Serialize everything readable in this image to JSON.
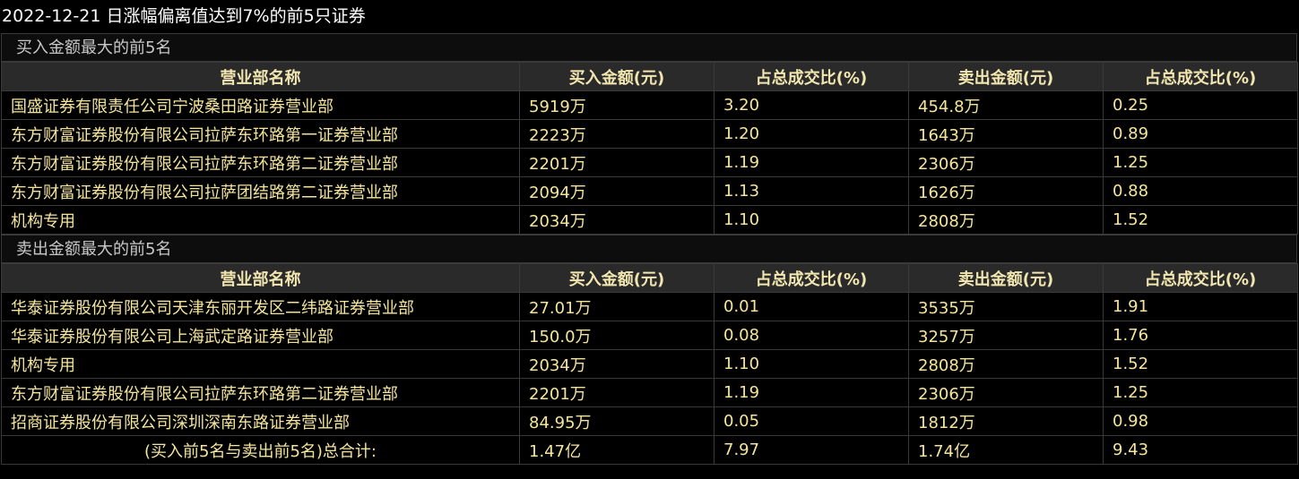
{
  "title": "2022-12-21 日涨幅偏离值达到7%的前5只证券",
  "headers": [
    "营业部名称",
    "买入金额(元)",
    "占总成交比(%)",
    "卖出金额(元)",
    "占总成交比(%)"
  ],
  "buy_section": {
    "label": "买入金额最大的前5名",
    "rows": [
      {
        "name": "国盛证券有限责任公司宁波桑田路证券营业部",
        "buy": "5919万",
        "buy_pct": "3.20",
        "sell": "454.8万",
        "sell_pct": "0.25"
      },
      {
        "name": "东方财富证券股份有限公司拉萨东环路第一证券营业部",
        "buy": "2223万",
        "buy_pct": "1.20",
        "sell": "1643万",
        "sell_pct": "0.89"
      },
      {
        "name": "东方财富证券股份有限公司拉萨东环路第二证券营业部",
        "buy": "2201万",
        "buy_pct": "1.19",
        "sell": "2306万",
        "sell_pct": "1.25"
      },
      {
        "name": "东方财富证券股份有限公司拉萨团结路第二证券营业部",
        "buy": "2094万",
        "buy_pct": "1.13",
        "sell": "1626万",
        "sell_pct": "0.88"
      },
      {
        "name": "机构专用",
        "buy": "2034万",
        "buy_pct": "1.10",
        "sell": "2808万",
        "sell_pct": "1.52"
      }
    ]
  },
  "sell_section": {
    "label": "卖出金额最大的前5名",
    "rows": [
      {
        "name": "华泰证券股份有限公司天津东丽开发区二纬路证券营业部",
        "buy": "27.01万",
        "buy_pct": "0.01",
        "sell": "3535万",
        "sell_pct": "1.91"
      },
      {
        "name": "华泰证券股份有限公司上海武定路证券营业部",
        "buy": "150.0万",
        "buy_pct": "0.08",
        "sell": "3257万",
        "sell_pct": "1.76"
      },
      {
        "name": "机构专用",
        "buy": "2034万",
        "buy_pct": "1.10",
        "sell": "2808万",
        "sell_pct": "1.52"
      },
      {
        "name": "东方财富证券股份有限公司拉萨东环路第二证券营业部",
        "buy": "2201万",
        "buy_pct": "1.19",
        "sell": "2306万",
        "sell_pct": "1.25"
      },
      {
        "name": "招商证券股份有限公司深圳深南东路证券营业部",
        "buy": "84.95万",
        "buy_pct": "0.05",
        "sell": "1812万",
        "sell_pct": "0.98"
      }
    ]
  },
  "total": {
    "label": "(买入前5名与卖出前5名)总合计:",
    "buy": "1.47亿",
    "buy_pct": "7.97",
    "sell": "1.74亿",
    "sell_pct": "9.43"
  }
}
